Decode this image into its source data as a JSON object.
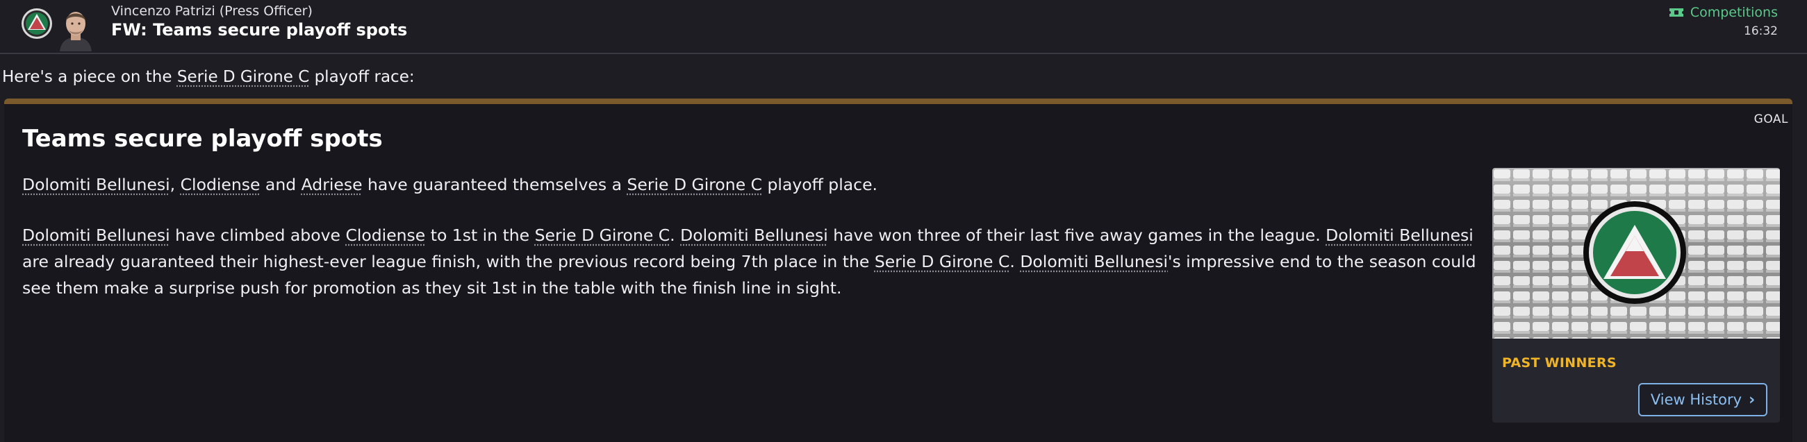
{
  "header": {
    "sender_name": "Vincenzo Patrizi",
    "sender_role": "(Press Officer)",
    "subject": "FW: Teams secure playoff spots",
    "category": "Competitions",
    "time": "16:32"
  },
  "intro": {
    "before": "Here's a piece on the ",
    "link": "Serie D Girone C",
    "after": " playoff race:"
  },
  "article": {
    "tag": "GOAL",
    "title": "Teams secure playoff spots",
    "p1": [
      {
        "t": "Dolomiti Bellunesi",
        "link": true
      },
      {
        "t": ", ",
        "link": false
      },
      {
        "t": "Clodiense",
        "link": true
      },
      {
        "t": " and ",
        "link": false
      },
      {
        "t": "Adriese",
        "link": true
      },
      {
        "t": " have guaranteed themselves a ",
        "link": false
      },
      {
        "t": "Serie D Girone C",
        "link": true
      },
      {
        "t": " playoff place.",
        "link": false
      }
    ],
    "p2": [
      {
        "t": "Dolomiti Bellunesi",
        "link": true
      },
      {
        "t": " have climbed above ",
        "link": false
      },
      {
        "t": "Clodiense",
        "link": true
      },
      {
        "t": " to 1st in the ",
        "link": false
      },
      {
        "t": "Serie D Girone C",
        "link": true
      },
      {
        "t": ". ",
        "link": false
      },
      {
        "t": "Dolomiti Bellunesi",
        "link": true
      },
      {
        "t": " have won three of their last five away games in the league. ",
        "link": false
      },
      {
        "t": "Dolomiti Bellunesi",
        "link": true
      },
      {
        "t": " are already guaranteed their highest-ever league finish, with the previous record being 7th place in the ",
        "link": false
      },
      {
        "t": "Serie D Girone C",
        "link": true
      },
      {
        "t": ". ",
        "link": false
      },
      {
        "t": "Dolomiti Bellunesi",
        "link": true
      },
      {
        "t": "'s impressive end to the season could see them make a surprise push for promotion as they sit 1st in the table with the finish line in sight.",
        "link": false
      }
    ]
  },
  "side_panel": {
    "section_title": "PAST WINNERS",
    "button_label": "View History"
  },
  "icons": {
    "badge": "club-badge-icon",
    "category": "ticket-icon",
    "chevron": "chevron-right-icon"
  },
  "colors": {
    "background": "#1d1d23",
    "card": "#17171d",
    "accent_bar": "#7a5a2a",
    "category_green": "#5bc98a",
    "past_winners": "#f0b526",
    "button_blue": "#8cc0f2",
    "badge_green": "#1f7a4a",
    "badge_red": "#c0444a"
  }
}
